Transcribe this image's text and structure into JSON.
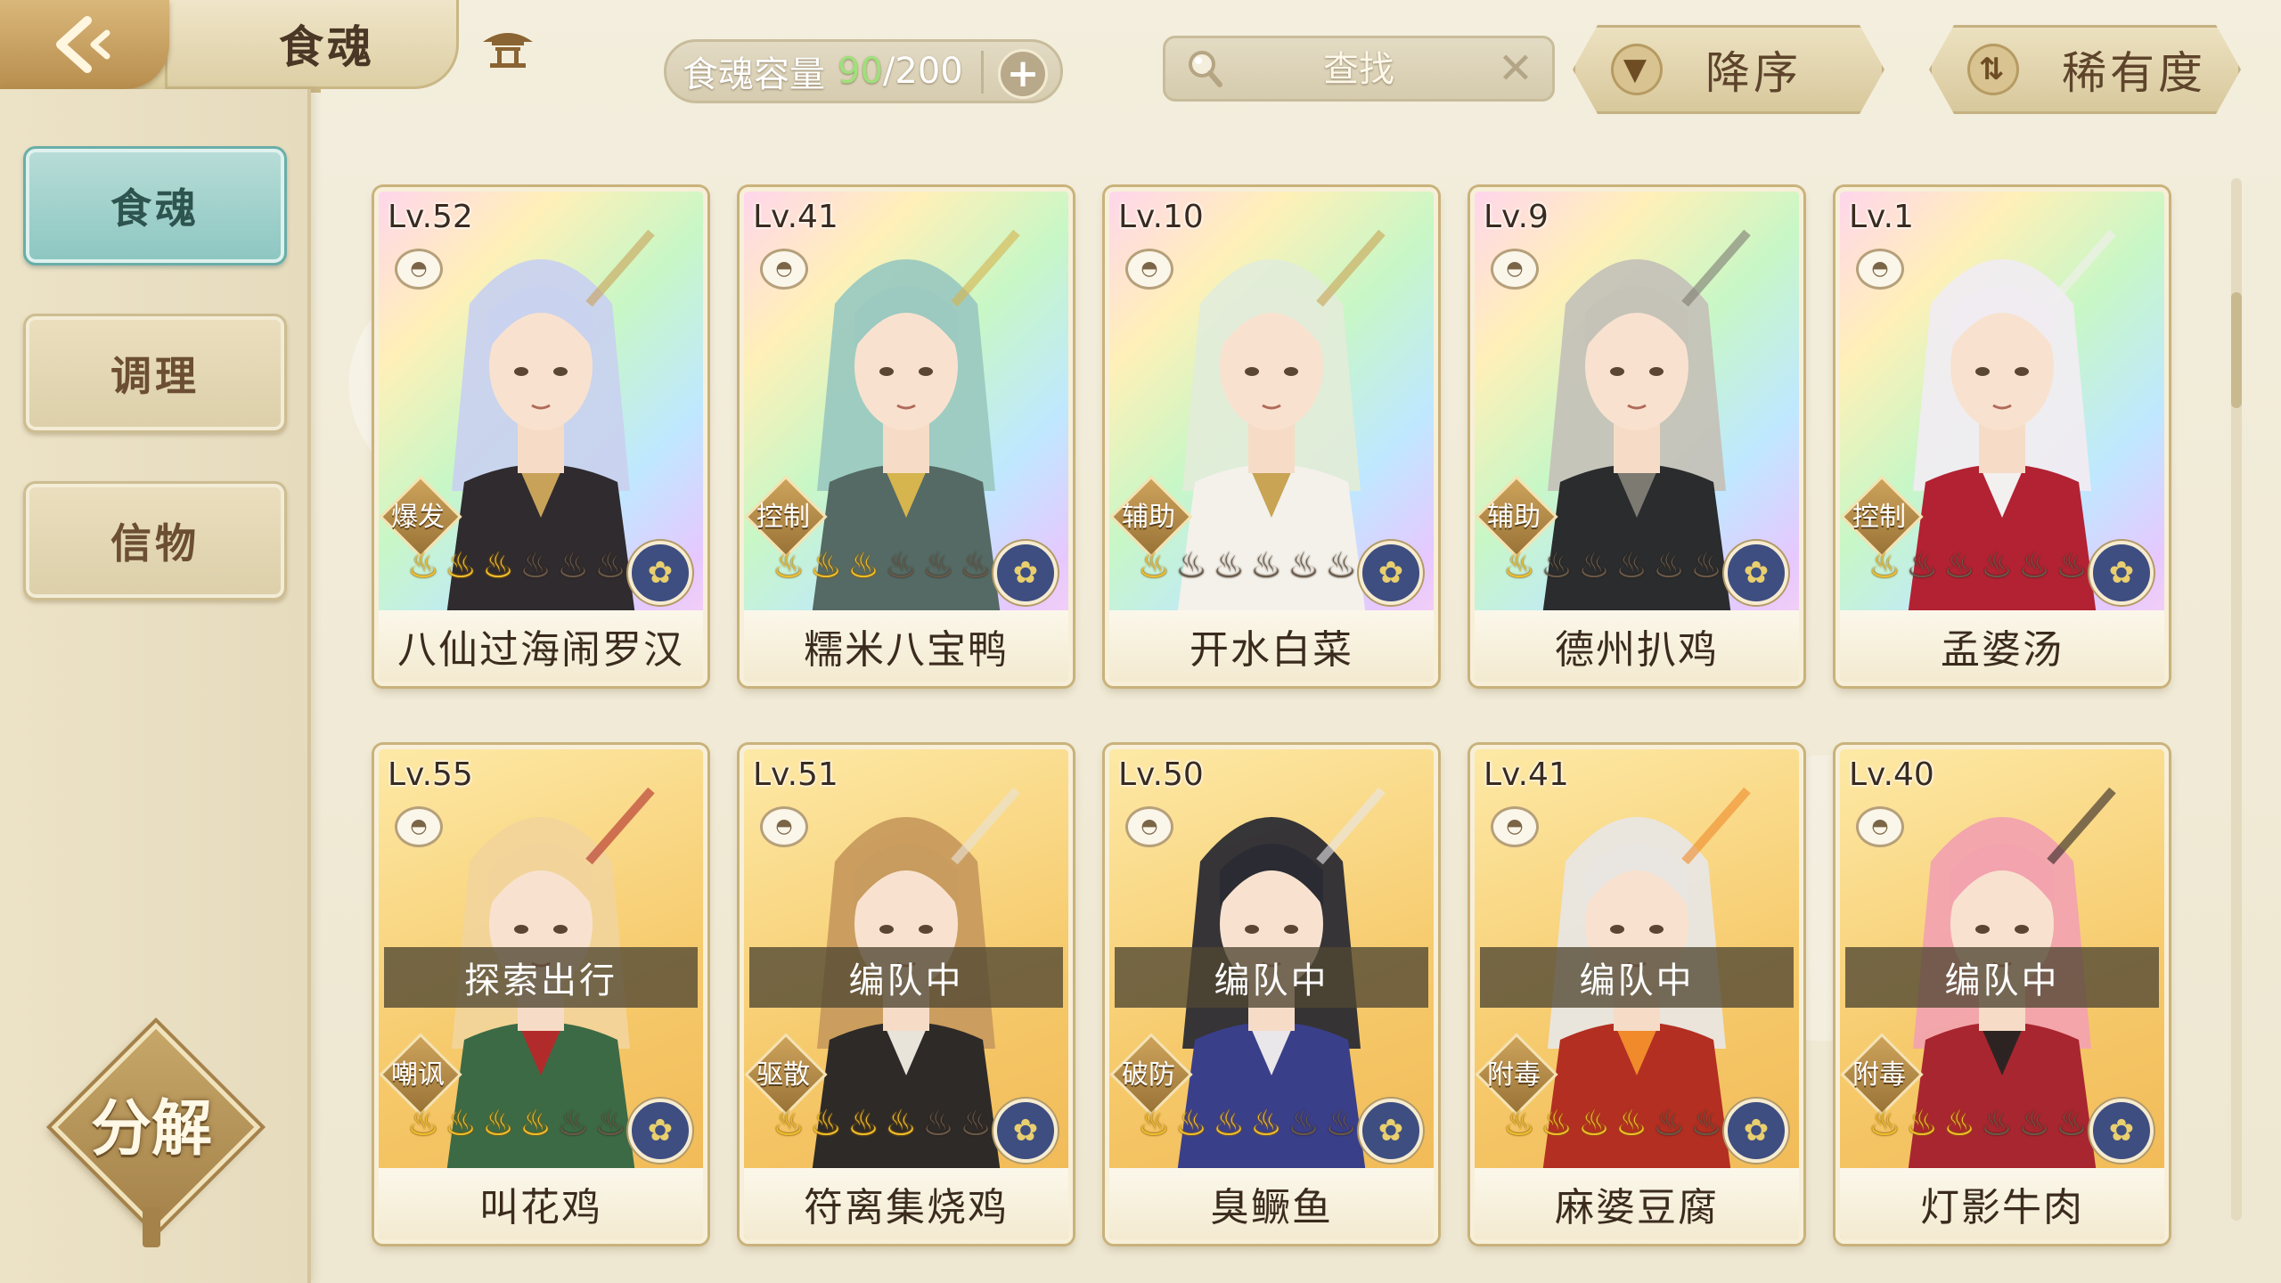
{
  "header": {
    "title": "食魂",
    "capacity_label": "食魂容量",
    "capacity_current": "90",
    "capacity_max": "/200",
    "search_placeholder": "查找",
    "sort_order_label": "降序",
    "sort_key_label": "稀有度"
  },
  "sidebar": {
    "items": [
      {
        "label": "食魂",
        "active": true
      },
      {
        "label": "调理",
        "active": false
      },
      {
        "label": "信物",
        "active": false
      }
    ],
    "decompose_label": "分解"
  },
  "cards": [
    {
      "level": "Lv.52",
      "name": "八仙过海闹罗汉",
      "role": "爆发",
      "stars": 3,
      "frame": "rainbow",
      "status": "",
      "hair": "#c9d2ee",
      "outfit": "#2f2b2e",
      "accent": "#c9a25a"
    },
    {
      "level": "Lv.41",
      "name": "糯米八宝鸭",
      "role": "控制",
      "stars": 3,
      "frame": "rainbow",
      "status": "",
      "hair": "#9cc9c0",
      "outfit": "#556a64",
      "accent": "#d6b44e"
    },
    {
      "level": "Lv.10",
      "name": "开水白菜",
      "role": "辅助",
      "stars": 1,
      "frame": "rainbow",
      "status": "",
      "hair": "#e2ecd8",
      "outfit": "#f3f1ea",
      "accent": "#c8a454"
    },
    {
      "level": "Lv.9",
      "name": "德州扒鸡",
      "role": "辅助",
      "stars": 1,
      "frame": "rainbow",
      "status": "",
      "hair": "#c5c2b8",
      "outfit": "#2a2c2e",
      "accent": "#7d7a72"
    },
    {
      "level": "Lv.1",
      "name": "孟婆汤",
      "role": "控制",
      "stars": 1,
      "frame": "rainbow",
      "status": "",
      "hair": "#f0ecf1",
      "outfit": "#b22233",
      "accent": "#f3f0f0"
    },
    {
      "level": "Lv.55",
      "name": "叫花鸡",
      "role": "嘲讽",
      "stars": 4,
      "frame": "gold",
      "status": "探索出行",
      "hair": "#f2d49a",
      "outfit": "#3c6a45",
      "accent": "#b22b2b"
    },
    {
      "level": "Lv.51",
      "name": "符离集烧鸡",
      "role": "驱散",
      "stars": 4,
      "frame": "gold",
      "status": "编队中",
      "hair": "#c89b5e",
      "outfit": "#2e2a28",
      "accent": "#e9e4da"
    },
    {
      "level": "Lv.50",
      "name": "臭鳜鱼",
      "role": "破防",
      "stars": 4,
      "frame": "gold",
      "status": "编队中",
      "hair": "#2b2b33",
      "outfit": "#3a3f8a",
      "accent": "#e9e7ea"
    },
    {
      "level": "Lv.41",
      "name": "麻婆豆腐",
      "role": "附毒",
      "stars": 4,
      "frame": "gold",
      "status": "编队中",
      "hair": "#e9e6e2",
      "outfit": "#b32f22",
      "accent": "#f08a2a"
    },
    {
      "level": "Lv.40",
      "name": "灯影牛肉",
      "role": "附毒",
      "stars": 3,
      "frame": "gold",
      "status": "编队中",
      "hair": "#f2a3ae",
      "outfit": "#a8262f",
      "accent": "#2e2323"
    }
  ]
}
